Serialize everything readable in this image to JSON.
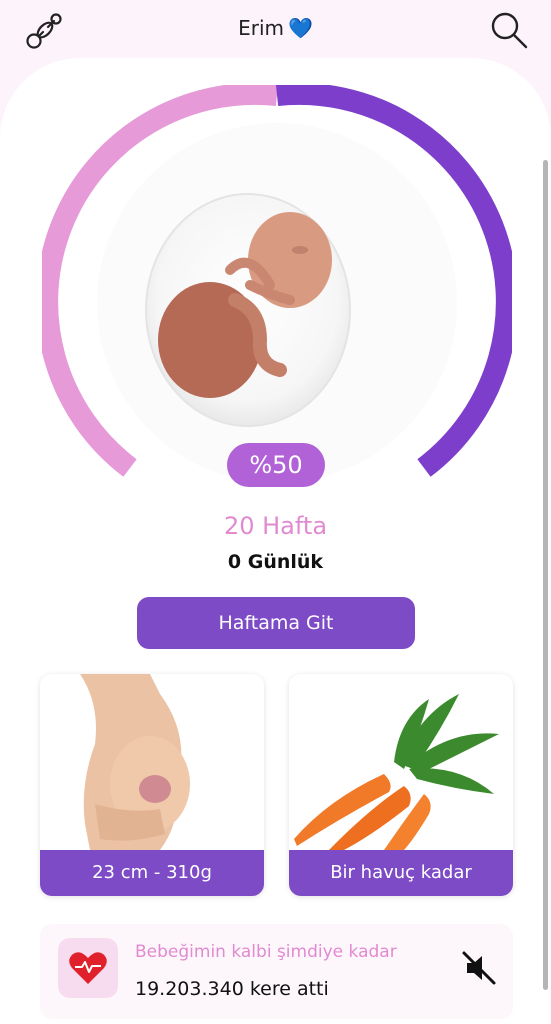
{
  "header": {
    "title": "Erim",
    "title_emoji": "💙",
    "left_icon": "pacifier-icon",
    "right_icon": "search-icon"
  },
  "progress": {
    "percent_label": "%50",
    "fraction": 0.5,
    "color_start": "#e69ad8",
    "color_end": "#7d3fcb"
  },
  "pregnancy": {
    "week_label": "20 Hafta",
    "day_label": "0 Günlük"
  },
  "go_button": {
    "label": "Haftama Git"
  },
  "cards": [
    {
      "label": "23 cm - 310g",
      "icon": "pregnant-belly-image"
    },
    {
      "label": "Bir havuç kadar",
      "icon": "carrot-image"
    }
  ],
  "heartbeat": {
    "title": "Bebeğimin kalbi şimdiye kadar",
    "count_text": "19.203.340 kere atti",
    "icon": "heart-pulse-icon",
    "mute_icon": "mute-icon"
  },
  "colors": {
    "accent_purple": "#7d4bc6",
    "accent_pink": "#e28ad0"
  }
}
